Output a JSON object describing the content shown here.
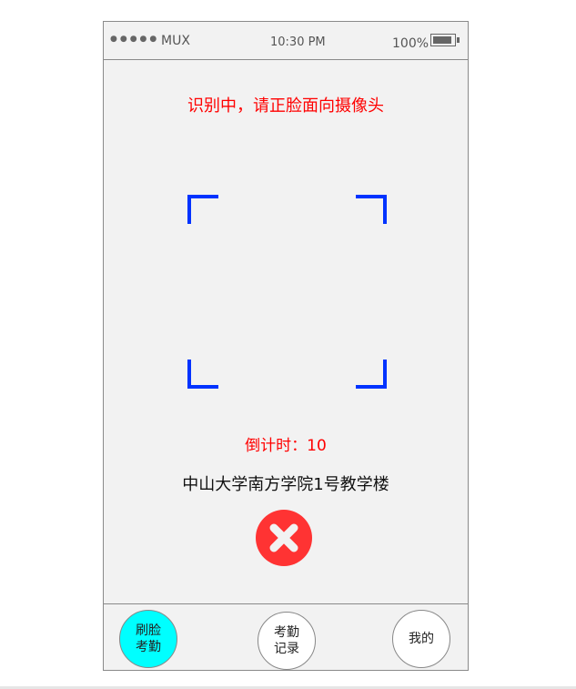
{
  "status": {
    "carrier": "MUX",
    "time": "10:30 PM",
    "battery": "100%"
  },
  "main": {
    "title": "识别中，请正脸面向摄像头",
    "countdown": "倒计时：10",
    "location": "中山大学南方学院1号教学楼"
  },
  "tabs": [
    {
      "label": "刷脸考勤",
      "active": true
    },
    {
      "label": "考勤记录"
    },
    {
      "label": "我的"
    }
  ],
  "colors": {
    "accent": "#00ffff",
    "alert": "#ff3333",
    "frame": "#0033ff"
  }
}
